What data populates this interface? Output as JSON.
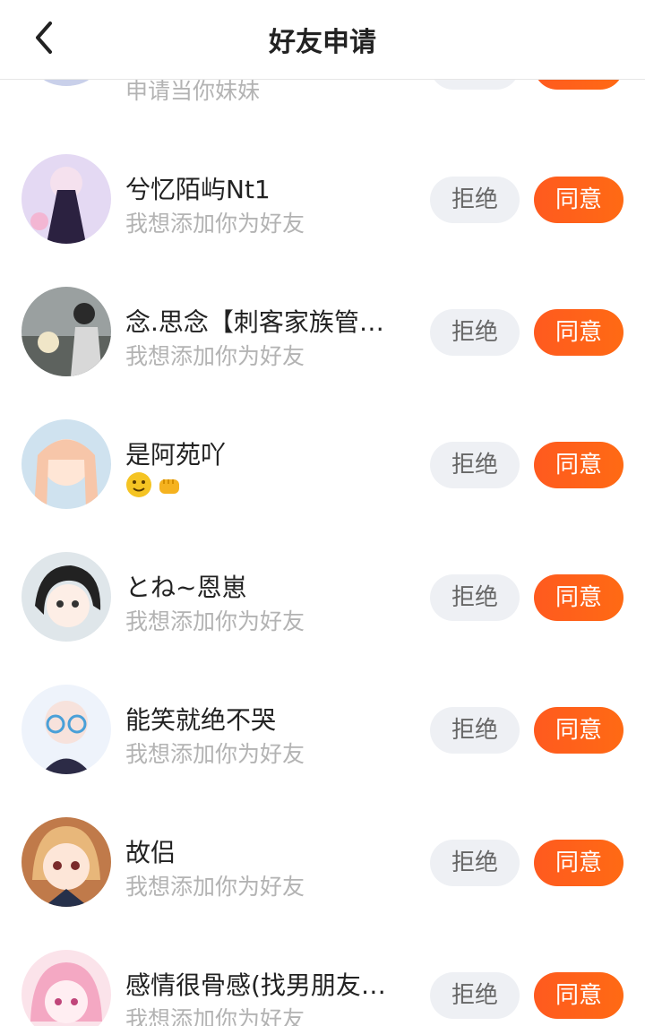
{
  "header": {
    "title": "好友申请",
    "back_icon": "chevron-left-icon"
  },
  "partial_row": {
    "message": "申请当你妹妹"
  },
  "buttons": {
    "reject": "拒绝",
    "accept": "同意"
  },
  "colors": {
    "accent": "#ff5a1f",
    "reject_bg": "#eef0f4"
  },
  "requests": [
    {
      "name": "兮忆陌屿Nt1",
      "message": "我想添加你为好友"
    },
    {
      "name": "念.思念【刺客家族管…",
      "message": "我想添加你为好友"
    },
    {
      "name": "是阿苑吖",
      "message": "",
      "emojis": [
        "smiling-face-icon",
        "fist-icon"
      ]
    },
    {
      "name": "とね~恩崽",
      "message": "我想添加你为好友"
    },
    {
      "name": "能笑就绝不哭",
      "message": "我想添加你为好友"
    },
    {
      "name": "故侣",
      "message": "我想添加你为好友"
    },
    {
      "name": "感情很骨感(找男朋友…",
      "message": "我想添加你为好友"
    }
  ]
}
